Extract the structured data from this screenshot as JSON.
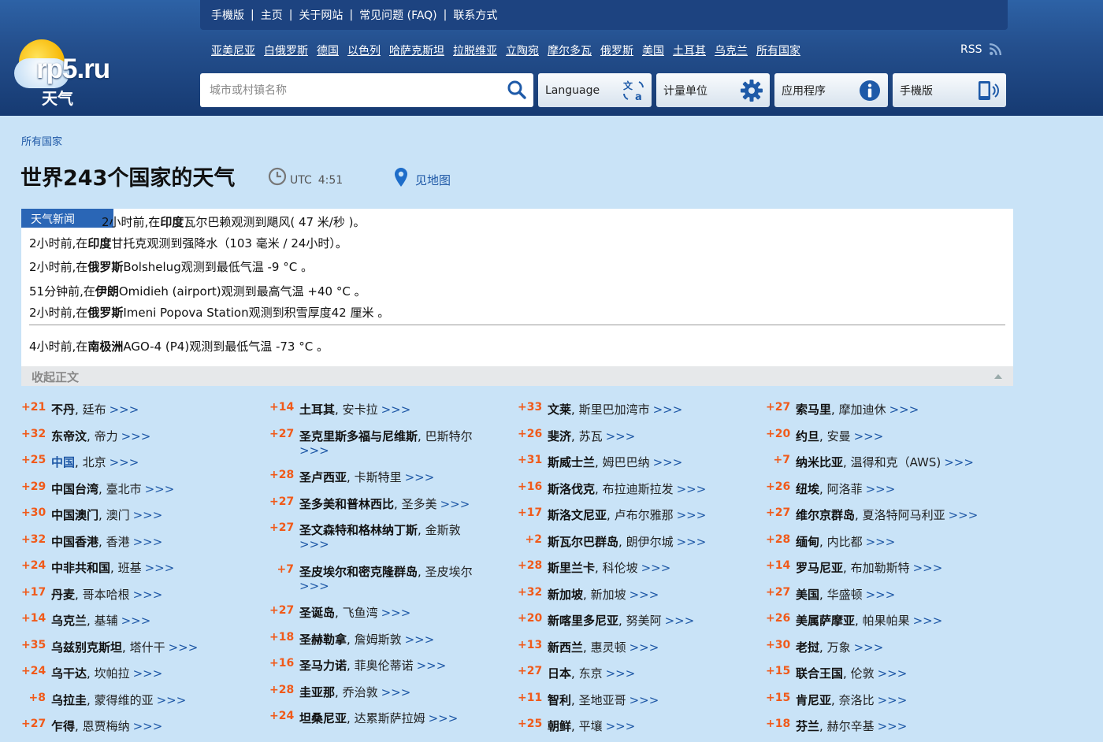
{
  "logo": {
    "text": "rp5.ru",
    "sub": "天气"
  },
  "topnav": [
    "手機版",
    "主页",
    "关于网站",
    "常见问题 (FAQ)",
    "联系方式"
  ],
  "countries": [
    "亚美尼亚",
    "白俄罗斯",
    "德国",
    "以色列",
    "哈萨克斯坦",
    "拉脱维亚",
    "立陶宛",
    "摩尔多瓦",
    "俄罗斯",
    "美国",
    "土耳其",
    "乌克兰",
    "所有国家"
  ],
  "rss": "RSS",
  "search": {
    "placeholder": "城市或村镇名称"
  },
  "buttons": {
    "language": "Language",
    "units": "计量单位",
    "apps": "应用程序",
    "mobile": "手機版"
  },
  "breadcrumb": "所有国家",
  "page_title": "世界243个国家的天气",
  "utc": {
    "label": "UTC",
    "time": "4:51"
  },
  "map_link": "见地图",
  "news": {
    "tag": "天气新闻",
    "items": [
      {
        "pre": "2小时前,在",
        "bold": "印度",
        "post": "瓦尔巴赖观测到飓风( 47 米/秒 )。"
      },
      {
        "pre": "2小时前,在",
        "bold": "印度",
        "post": "甘托克观测到强降水（103 毫米 / 24小时）。"
      },
      {
        "pre": "2小时前,在",
        "bold": "俄罗斯",
        "post": "Bolshelug观测到最低气温 -9 °C 。"
      },
      {
        "pre": "51分钟前,在",
        "bold": "伊朗",
        "post": "Omidieh (airport)观测到最高气温 +40 °C 。"
      },
      {
        "pre": "2小时前,在",
        "bold": "俄罗斯",
        "post": "Imeni Popova Station观测到积雪厚度42 厘米 。"
      },
      {
        "pre": "4小时前,在",
        "bold": "南极洲",
        "post": "AGO-4 (P4)观测到最低气温 -73 °C 。"
      }
    ],
    "collapse": "收起正文"
  },
  "more_label": ">>>",
  "columns": [
    [
      {
        "temp": "+21",
        "country": "不丹",
        "capital": "廷布"
      },
      {
        "temp": "+32",
        "country": "东帝汶",
        "capital": "帝力"
      },
      {
        "temp": "+25",
        "country": "中国",
        "capital": "北京",
        "link": true
      },
      {
        "temp": "+29",
        "country": "中国台湾",
        "capital": "臺北市"
      },
      {
        "temp": "+30",
        "country": "中国澳门",
        "capital": "澳门"
      },
      {
        "temp": "+32",
        "country": "中国香港",
        "capital": "香港"
      },
      {
        "temp": "+24",
        "country": "中非共和国",
        "capital": "班基"
      },
      {
        "temp": "+17",
        "country": "丹麦",
        "capital": "哥本哈根"
      },
      {
        "temp": "+14",
        "country": "乌克兰",
        "capital": "基辅"
      },
      {
        "temp": "+35",
        "country": "乌兹别克斯坦",
        "capital": "塔什干"
      },
      {
        "temp": "+24",
        "country": "乌干达",
        "capital": "坎帕拉"
      },
      {
        "temp": "+8",
        "country": "乌拉圭",
        "capital": "蒙得维的亚"
      },
      {
        "temp": "+27",
        "country": "乍得",
        "capital": "恩贾梅纳"
      }
    ],
    [
      {
        "temp": "+14",
        "country": "土耳其",
        "capital": "安卡拉"
      },
      {
        "temp": "+27",
        "country": "圣克里斯多福与尼维斯",
        "capital": "巴斯特尔",
        "wrap": true
      },
      {
        "temp": "+28",
        "country": "圣卢西亚",
        "capital": "卡斯特里"
      },
      {
        "temp": "+27",
        "country": "圣多美和普林西比",
        "capital": "圣多美"
      },
      {
        "temp": "+27",
        "country": "圣文森特和格林纳丁斯",
        "capital": "金斯敦",
        "wrap": true
      },
      {
        "temp": "+7",
        "country": "圣皮埃尔和密克隆群岛",
        "capital": "圣皮埃尔",
        "wrap": true
      },
      {
        "temp": "+27",
        "country": "圣诞岛",
        "capital": "飞鱼湾"
      },
      {
        "temp": "+18",
        "country": "圣赫勒拿",
        "capital": "詹姆斯敦"
      },
      {
        "temp": "+16",
        "country": "圣马力诺",
        "capital": "菲奥伦蒂诺"
      },
      {
        "temp": "+28",
        "country": "圭亚那",
        "capital": "乔治敦"
      },
      {
        "temp": "+24",
        "country": "坦桑尼亚",
        "capital": "达累斯萨拉姆"
      }
    ],
    [
      {
        "temp": "+33",
        "country": "文莱",
        "capital": "斯里巴加湾市"
      },
      {
        "temp": "+26",
        "country": "斐济",
        "capital": "苏瓦"
      },
      {
        "temp": "+31",
        "country": "斯威士兰",
        "capital": "姆巴巴纳"
      },
      {
        "temp": "+16",
        "country": "斯洛伐克",
        "capital": "布拉迪斯拉发"
      },
      {
        "temp": "+17",
        "country": "斯洛文尼亚",
        "capital": "卢布尔雅那"
      },
      {
        "temp": "+2",
        "country": "斯瓦尔巴群岛",
        "capital": "朗伊尔城"
      },
      {
        "temp": "+28",
        "country": "斯里兰卡",
        "capital": "科伦坡"
      },
      {
        "temp": "+32",
        "country": "新加坡",
        "capital": "新加坡"
      },
      {
        "temp": "+20",
        "country": "新喀里多尼亚",
        "capital": "努美阿"
      },
      {
        "temp": "+13",
        "country": "新西兰",
        "capital": "惠灵顿"
      },
      {
        "temp": "+27",
        "country": "日本",
        "capital": "东京"
      },
      {
        "temp": "+11",
        "country": "智利",
        "capital": "圣地亚哥"
      },
      {
        "temp": "+25",
        "country": "朝鲜",
        "capital": "平壤"
      }
    ],
    [
      {
        "temp": "+27",
        "country": "索马里",
        "capital": "摩加迪休"
      },
      {
        "temp": "+20",
        "country": "约旦",
        "capital": "安曼"
      },
      {
        "temp": "+7",
        "country": "纳米比亚",
        "capital": "温得和克（AWS)"
      },
      {
        "temp": "+26",
        "country": "纽埃",
        "capital": "阿洛菲"
      },
      {
        "temp": "+27",
        "country": "维尔京群岛",
        "capital": "夏洛特阿马利亚"
      },
      {
        "temp": "+28",
        "country": "缅甸",
        "capital": "内比都"
      },
      {
        "temp": "+14",
        "country": "罗马尼亚",
        "capital": "布加勒斯特"
      },
      {
        "temp": "+27",
        "country": "美国",
        "capital": "华盛顿"
      },
      {
        "temp": "+26",
        "country": "美属萨摩亚",
        "capital": "帕果帕果"
      },
      {
        "temp": "+30",
        "country": "老挝",
        "capital": "万象"
      },
      {
        "temp": "+15",
        "country": "联合王国",
        "capital": "伦敦"
      },
      {
        "temp": "+15",
        "country": "肯尼亚",
        "capital": "奈洛比"
      },
      {
        "temp": "+18",
        "country": "芬兰",
        "capital": "赫尔辛基"
      }
    ]
  ]
}
